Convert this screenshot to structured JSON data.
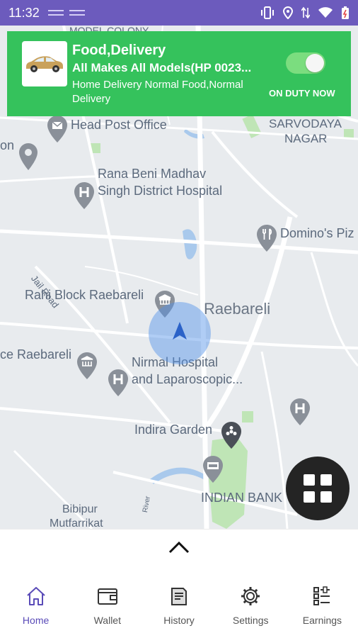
{
  "status_bar": {
    "time": "11:32"
  },
  "map": {
    "labels": {
      "model_colony": "MODEL COLONY",
      "head_post_office": "Head Post Office",
      "sarvodaya_line1": "SARVODAYA",
      "sarvodaya_line2": "NAGAR",
      "on_partial": "on",
      "hospital_line1": "Rana Beni Madhav",
      "hospital_line2": "Singh District Hospital",
      "dominos": "Domino's Piz",
      "jail_road": "Jail Road",
      "rahi_block": "Rahi Block Raebareli",
      "city": "Raebareli",
      "police_partial": "ce Raebareli",
      "nirmal_line1": "Nirmal Hospital",
      "nirmal_line2": "and Laparoscopic...",
      "indira_garden": "Indira Garden",
      "indian_bank": "INDIAN BANK",
      "bibipur_line1": "Bibipur",
      "bibipur_line2": "Mutfarrikat",
      "river": "River"
    }
  },
  "duty_card": {
    "title": "Food,Delivery",
    "vehicle_model": "All Makes All Models(HP 0023...",
    "description": "Home Delivery Normal Food,Normal Delivery",
    "status_label": "ON DUTY NOW",
    "on_duty": true,
    "color": "#35c25c"
  },
  "nav": {
    "items": [
      {
        "label": "Home",
        "icon": "home-icon",
        "active": true
      },
      {
        "label": "Wallet",
        "icon": "wallet-icon",
        "active": false
      },
      {
        "label": "History",
        "icon": "history-icon",
        "active": false
      },
      {
        "label": "Settings",
        "icon": "gear-icon",
        "active": false
      },
      {
        "label": "Earnings",
        "icon": "earnings-icon",
        "active": false
      }
    ],
    "active_color": "#5a4bb8"
  },
  "theme": {
    "status_bar": "#6c5bbd",
    "map_background": "#e8ebee",
    "accuracy_circle": "#4f91e8"
  }
}
